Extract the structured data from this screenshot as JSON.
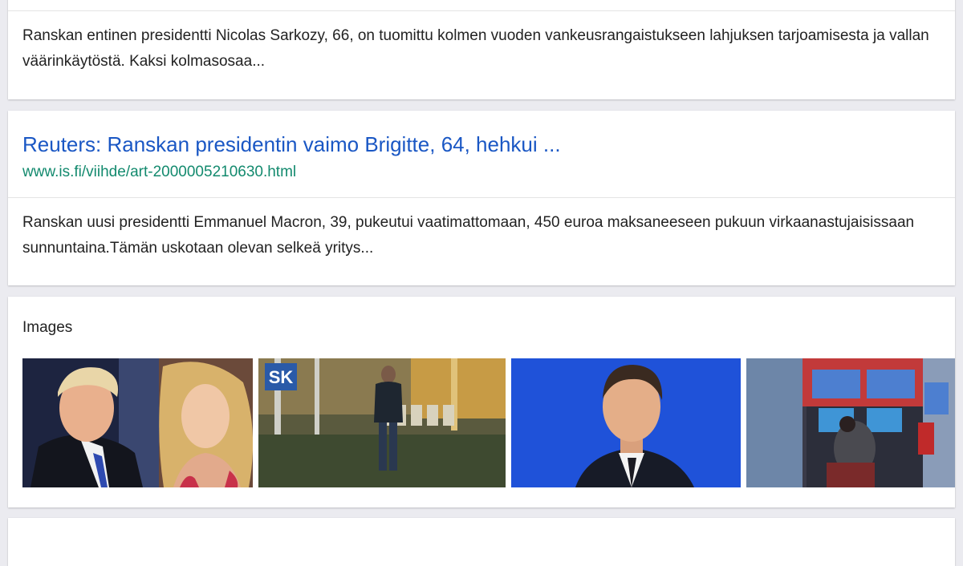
{
  "previous_result": {
    "snippet": "Ranskan entinen presidentti Nicolas Sarkozy, 66, on tuomittu kolmen vuoden vankeusrangaistukseen lahjuksen tarjoamisesta ja vallan väärinkäytöstä. Kaksi kolmasosaa..."
  },
  "result": {
    "title": "Reuters: Ranskan presidentin vaimo Brigitte, 64, hehkui ...",
    "url": "www.is.fi/viihde/art-2000005210630.html",
    "snippet": "Ranskan uusi presidentti Emmanuel Macron, 39, pukeutui vaatimattomaan, 450 euroa maksaneeseen pukuun virkaanastujaisissaan sunnuntaina.Tämän uskotaan olevan selkeä yritys..."
  },
  "images": {
    "heading": "Images",
    "thumbnails": [
      {
        "name": "image-thumbnail-two-portraits"
      },
      {
        "name": "image-thumbnail-man-in-hall",
        "badge": "SK"
      },
      {
        "name": "image-thumbnail-man-portrait-blue"
      },
      {
        "name": "image-thumbnail-arcade"
      }
    ]
  },
  "colors": {
    "page_background": "#ebebf0",
    "card_background": "#ffffff",
    "link_title": "#1a57c4",
    "url_green": "#138a6e",
    "body_text": "#222222"
  }
}
